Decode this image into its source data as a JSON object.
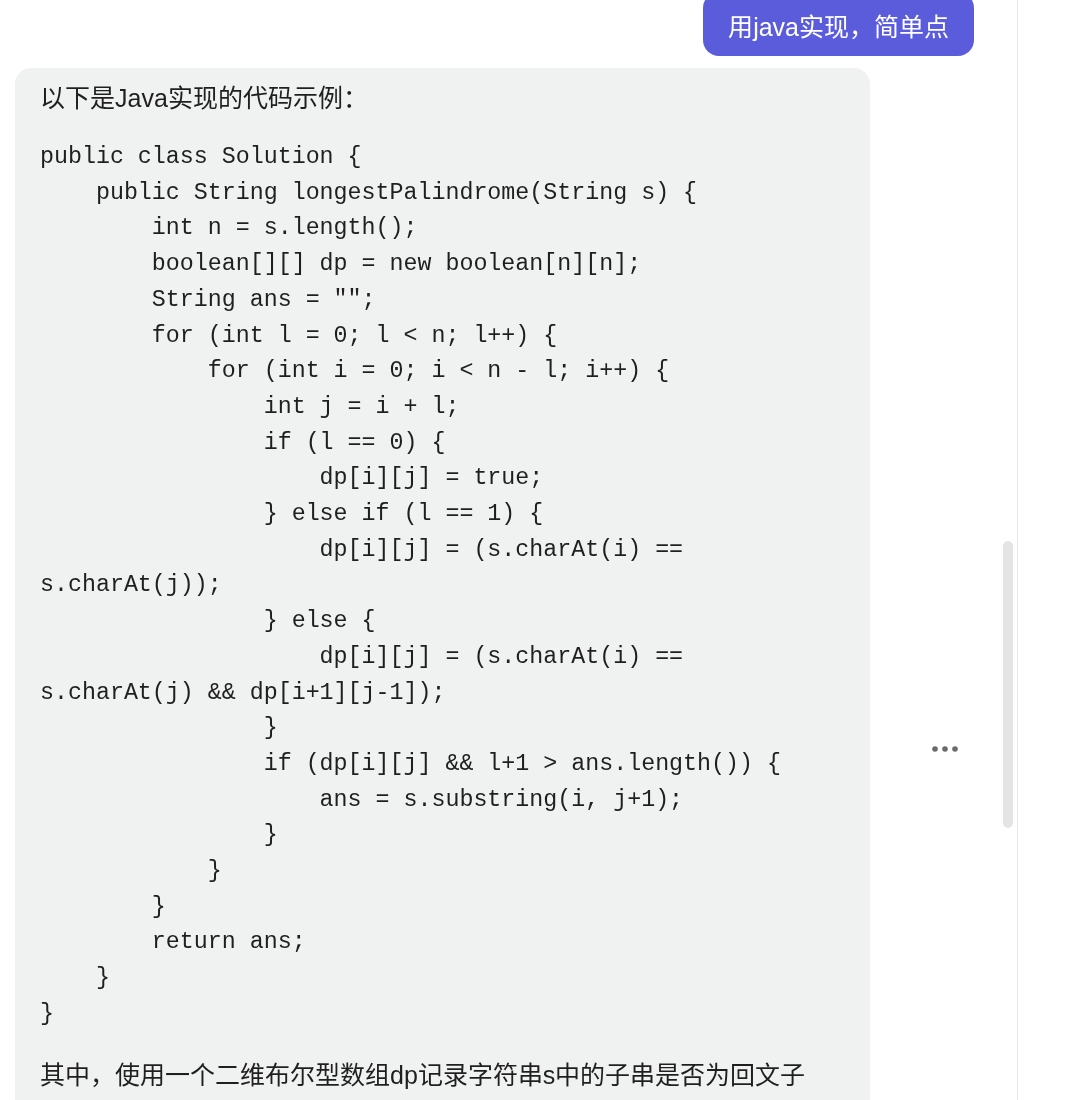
{
  "messages": [
    {
      "kind": "user",
      "text": "用java实现，简单点"
    },
    {
      "kind": "assistant",
      "blocks": [
        {
          "kind": "paragraph",
          "text": "以下是Java实现的代码示例："
        },
        {
          "kind": "code",
          "text": "public class Solution {\n    public String longestPalindrome(String s) {\n        int n = s.length();\n        boolean[][] dp = new boolean[n][n];\n        String ans = \"\";\n        for (int l = 0; l < n; l++) {\n            for (int i = 0; i < n - l; i++) {\n                int j = i + l;\n                if (l == 0) {\n                    dp[i][j] = true;\n                } else if (l == 1) {\n                    dp[i][j] = (s.charAt(i) == s.charAt(j));\n                } else {\n                    dp[i][j] = (s.charAt(i) == s.charAt(j) && dp[i+1][j-1]);\n                }\n                if (dp[i][j] && l+1 > ans.length()) {\n                    ans = s.substring(i, j+1);\n                }\n            }\n        }\n        return ans;\n    }\n}"
        },
        {
          "kind": "paragraph",
          "text": "其中，使用一个二维布尔型数组dp记录字符串s中的子串是否为回文子"
        }
      ]
    }
  ]
}
